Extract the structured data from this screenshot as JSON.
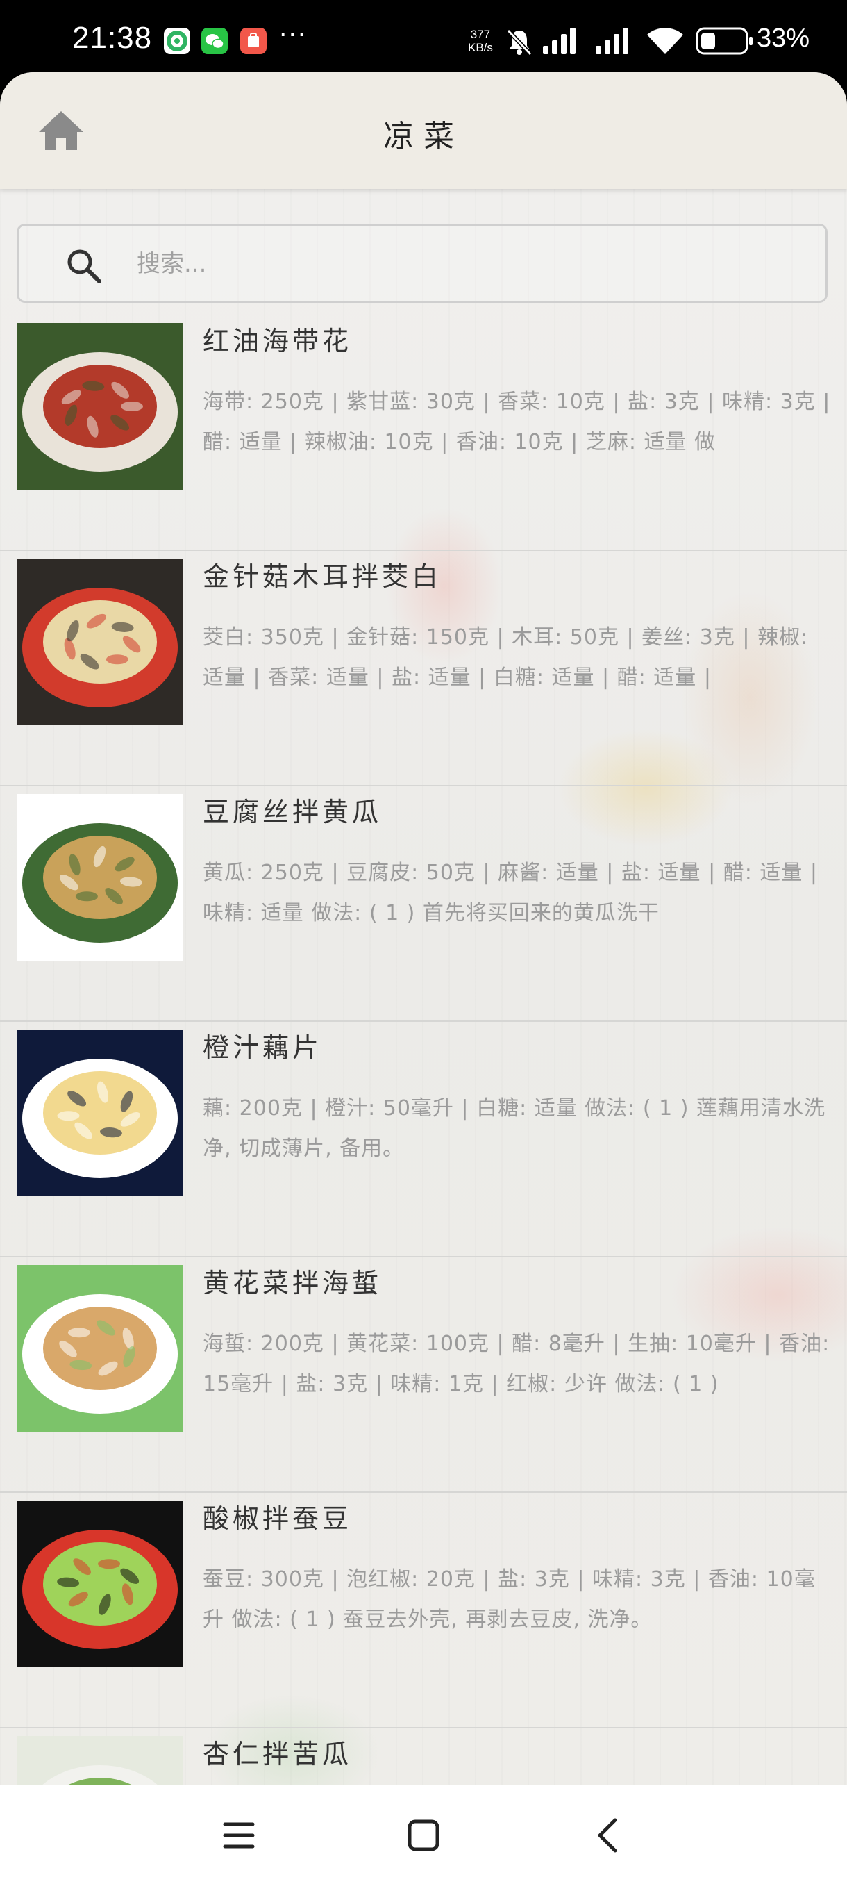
{
  "status_bar": {
    "time": "21:38",
    "more": "···",
    "net_speed_value": "377",
    "net_speed_unit": "KB/s",
    "battery": "33%",
    "notification_apps": [
      {
        "name": "app-green-swirl-icon",
        "color": "#2fb463"
      },
      {
        "name": "wechat-icon",
        "color": "#28c445"
      },
      {
        "name": "app-red-icon",
        "color": "#f2574a"
      }
    ]
  },
  "header": {
    "title": "凉菜",
    "home_icon": "home-icon"
  },
  "search": {
    "placeholder": "搜索...",
    "value": ""
  },
  "recipes": [
    {
      "name": "红油海带花",
      "desc": "海带: 250克 | 紫甘蓝: 30克 | 香菜: 10克 | 盐: 3克 | 味精: 3克 | 醋: 适量 | 辣椒油: 10克 | 香油: 10克 | 芝麻: 适量  做",
      "thumb_colors": [
        "#3b5a2c",
        "#b33a2a",
        "#e9e3d9"
      ]
    },
    {
      "name": "金针菇木耳拌茭白",
      "desc": "茭白: 350克 | 金针菇: 150克 | 木耳: 50克 | 姜丝: 3克 | 辣椒: 适量 | 香菜: 适量 | 盐: 适量 | 白糖: 适量 | 醋: 适量 |",
      "thumb_colors": [
        "#2e2a26",
        "#e9d8a6",
        "#d23b2c"
      ]
    },
    {
      "name": "豆腐丝拌黄瓜",
      "desc": "黄瓜: 250克 | 豆腐皮: 50克 | 麻酱: 适量 | 盐: 适量 | 醋: 适量 | 味精: 适量  做法: ( 1 ) 首先将买回来的黄瓜洗干",
      "thumb_colors": [
        "#ffffff",
        "#c9a25a",
        "#3f6b34"
      ]
    },
    {
      "name": "橙汁藕片",
      "desc": "藕: 200克 | 橙汁: 50毫升 | 白糖: 适量  做法: ( 1 ) 莲藕用清水洗净, 切成薄片, 备用。",
      "thumb_colors": [
        "#0f1a3a",
        "#f2d98f",
        "#ffffff"
      ]
    },
    {
      "name": "黄花菜拌海蜇",
      "desc": "海蜇: 200克 | 黄花菜: 100克 | 醋: 8毫升 | 生抽: 10毫升 | 香油: 15毫升 | 盐: 3克 | 味精: 1克 | 红椒: 少许  做法: ( 1 )",
      "thumb_colors": [
        "#7cc36a",
        "#d9a86a",
        "#ffffff"
      ]
    },
    {
      "name": "酸椒拌蚕豆",
      "desc": "蚕豆: 300克 | 泡红椒: 20克 | 盐: 3克 | 味精: 3克 | 香油: 10毫升  做法: ( 1 ) 蚕豆去外壳, 再剥去豆皮, 洗净。",
      "thumb_colors": [
        "#111111",
        "#9fd35a",
        "#d8362a"
      ]
    },
    {
      "name": "杏仁拌苦瓜",
      "desc": "",
      "thumb_colors": [
        "#e6eadf",
        "#7fb35a",
        "#f2f2ee"
      ]
    }
  ],
  "nav": {
    "menu_icon": "menu-icon",
    "home_icon": "nav-home-icon",
    "back_icon": "back-icon"
  }
}
